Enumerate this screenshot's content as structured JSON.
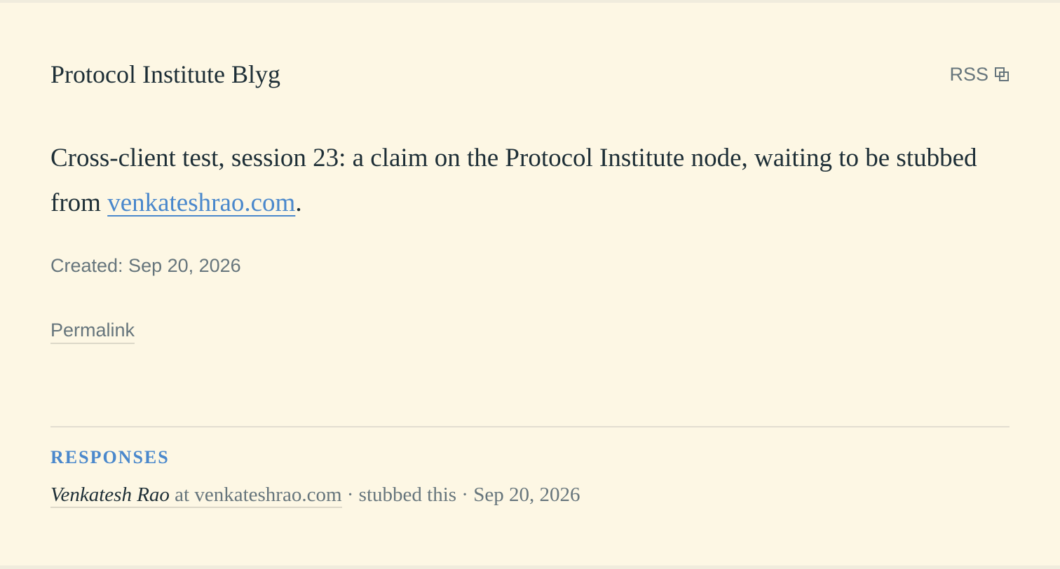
{
  "header": {
    "site_title": "Protocol Institute Blyg",
    "rss_label": "RSS"
  },
  "post": {
    "text_before": "Cross-client test, session 23: a claim on the Protocol Institute node, waiting to be stubbed from ",
    "link_text": "venkateshrao.com",
    "text_after": ".",
    "created": "Created: Sep 20, 2026",
    "permalink_label": "Permalink"
  },
  "responses": {
    "heading": "RESPONSES",
    "items": [
      {
        "author": "Venkatesh Rao",
        "site": " at venkateshrao.com",
        "action": " · stubbed this · Sep 20, 2026"
      }
    ]
  },
  "colors": {
    "page_background": "#fdf7e4",
    "text": "#1d2e36",
    "muted": "#66757c",
    "accent": "#4a88cc"
  },
  "icons": {
    "rss": "external-link-icon"
  }
}
